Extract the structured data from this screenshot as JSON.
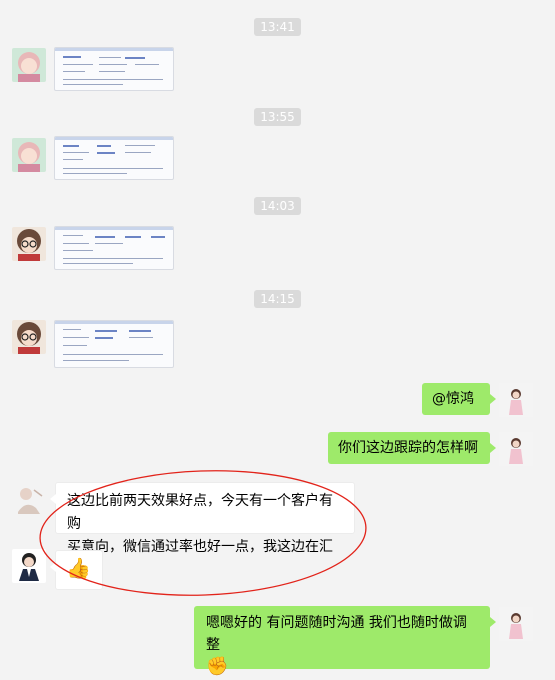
{
  "timestamps": [
    "13:41",
    "13:55",
    "14:03",
    "14:15"
  ],
  "messages": {
    "mention": "@惊鸿",
    "question": "你们这边跟踪的怎样啊",
    "reply_line1": "这边比前两天效果好点，今天有一个客户有购",
    "reply_line2": "买意向，微信通过率也好一点，我这边在汇总",
    "final": "嗯嗯好的 有问题随时沟通 我们也随时做调整"
  },
  "icons": {
    "thumbs_up": "👍",
    "fist": "✊"
  },
  "colors": {
    "background": "#f3f3f3",
    "sent_bubble": "#9eea6a",
    "received_bubble": "#ffffff",
    "annotation_ellipse": "#e2231a"
  }
}
